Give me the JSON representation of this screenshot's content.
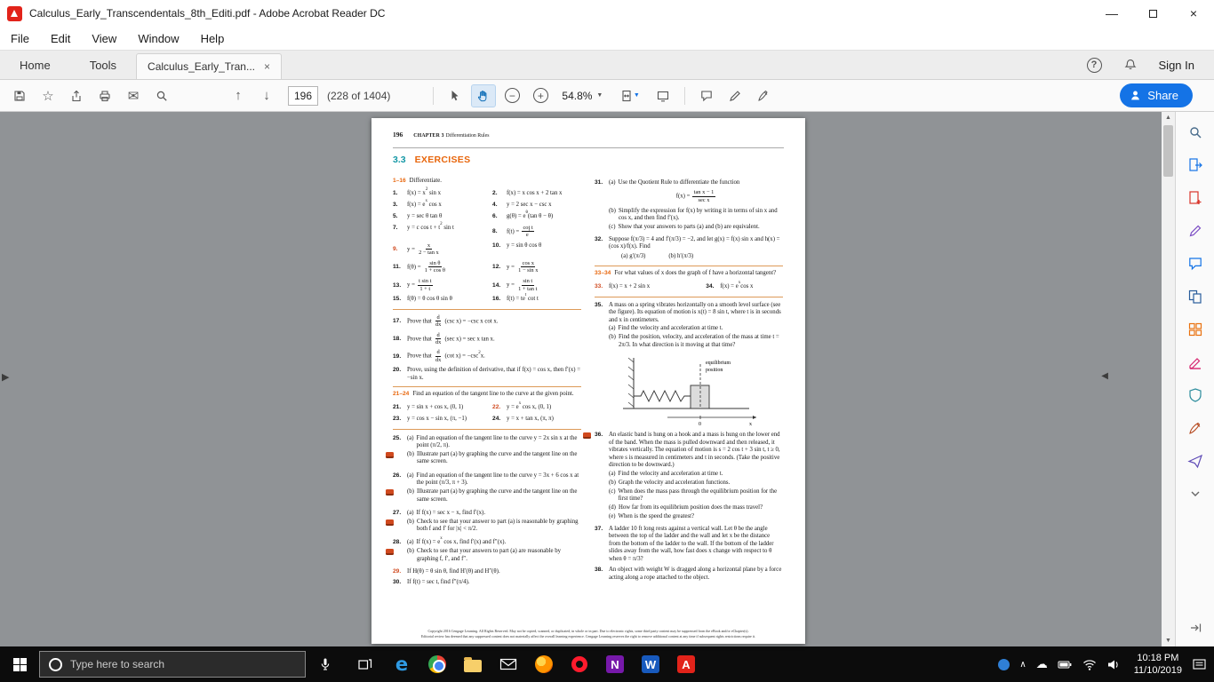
{
  "theme": {
    "accent_blue": "#1473e6",
    "teal": "#1598a6",
    "orange": "#e8660c",
    "red_num": "#d0491e",
    "acrobat_red": "#e2231a",
    "workspace": "#909396"
  },
  "titlebar": {
    "title": "Calculus_Early_Transcendentals_8th_Editi.pdf - Adobe Acrobat Reader DC"
  },
  "menubar": {
    "items": [
      "File",
      "Edit",
      "View",
      "Window",
      "Help"
    ]
  },
  "tabbar": {
    "home": "Home",
    "tools": "Tools",
    "doc": "Calculus_Early_Tran...",
    "sign_in": "Sign In"
  },
  "toolbar": {
    "page_current": "196",
    "page_total": "(228 of 1404)",
    "zoom_level": "54.8%",
    "share_label": "Share"
  },
  "glyphs": {
    "close": "×",
    "minimize": "—",
    "star": "☆",
    "email": "✉",
    "page_up": "↑",
    "page_down": "↓",
    "caret": "▼",
    "scroll_up": "▲",
    "scroll_down": "▼",
    "pane_right": "▶",
    "pane_left": "◀",
    "tray_chevron": "∧",
    "cloud": "☁",
    "help": "?",
    "zoom_minus": "−",
    "zoom_plus": "+",
    "tab_close": "×"
  },
  "page": {
    "folio": "196",
    "chapter_label": "CHAPTER 3",
    "chapter_title": "Differentiation Rules",
    "section_number": "3.3",
    "section_title": "EXERCISES",
    "g1": {
      "range": "1–16",
      "text": "Differentiate."
    },
    "ex_1_16": [
      {
        "n": "1.",
        "m": "f(x) = x^2^ sin x"
      },
      {
        "n": "2.",
        "m": "f(x) = x cos x + 2 tan x"
      },
      {
        "n": "3.",
        "m": "f(x) = e^x^ cos x"
      },
      {
        "n": "4.",
        "m": "y = 2 sec x − csc x"
      },
      {
        "n": "5.",
        "m": "y = sec θ tan θ"
      },
      {
        "n": "6.",
        "m": "g(θ) = e^θ^(tan θ − θ)"
      },
      {
        "n": "7.",
        "m": "y = c cos t + t^2^ sin t"
      },
      {
        "n": "8.",
        "m": "f(t) = [[cot t||e^t^]]"
      },
      {
        "n": "9.",
        "red": true,
        "m": "y = [[x||2 − tan x]]"
      },
      {
        "n": "10.",
        "m": "y = sin θ cos θ"
      },
      {
        "n": "11.",
        "m": "f(θ) = [[sin θ||1 + cos θ]]"
      },
      {
        "n": "12.",
        "m": "y = [[cos x||1 − sin x]]"
      },
      {
        "n": "13.",
        "m": "y = [[t sin t||1 + t]]"
      },
      {
        "n": "14.",
        "m": "y = [[sin t||1 + tan t]]"
      },
      {
        "n": "15.",
        "m": "f(θ) = θ cos θ sin θ"
      },
      {
        "n": "16.",
        "m": "f(t) = te^t^ cot t"
      }
    ],
    "ex_17_20": [
      {
        "n": "17.",
        "m": "Prove that [[d||dx]] (csc x) = −csc x cot x."
      },
      {
        "n": "18.",
        "m": "Prove that [[d||dx]] (sec x) = sec x tan x."
      },
      {
        "n": "19.",
        "m": "Prove that [[d||dx]] (cot x) = −csc^2^x."
      },
      {
        "n": "20.",
        "m": "Prove, using the definition of derivative, that if f(x) = cos x, then f′(x) = −sin x."
      }
    ],
    "g2": {
      "range": "21–24",
      "text": "Find an equation of the tangent line to the curve at the given point."
    },
    "ex_21_24": [
      {
        "n": "21.",
        "m": "y = sin x + cos x,  (0, 1)"
      },
      {
        "n": "22.",
        "red": true,
        "m": "y = e^x^ cos x,  (0, 1)"
      },
      {
        "n": "23.",
        "m": "y = cos x − sin x,  (π, −1)"
      },
      {
        "n": "24.",
        "m": "y = x + tan x,  (π, π)"
      }
    ],
    "ex_25_30": [
      {
        "n": "25.",
        "parts": [
          {
            "p": "(a)",
            "m": "Find an equation of the tangent line to the curve y = 2x sin x at the point (π/2, π)."
          },
          {
            "p": "(b)",
            "icon": true,
            "m": "Illustrate part (a) by graphing the curve and the tangent line on the same screen."
          }
        ]
      },
      {
        "n": "26.",
        "parts": [
          {
            "p": "(a)",
            "m": "Find an equation of the tangent line to the curve y = 3x + 6 cos x at the point (π/3, π + 3)."
          },
          {
            "p": "(b)",
            "icon": true,
            "m": "Illustrate part (a) by graphing the curve and the tangent line on the same screen."
          }
        ]
      },
      {
        "n": "27.",
        "parts": [
          {
            "p": "(a)",
            "m": "If f(x) = sec x − x, find f′(x)."
          },
          {
            "p": "(b)",
            "icon": true,
            "m": "Check to see that your answer to part (a) is reasonable by graphing both f and f′ for |x| < π/2."
          }
        ]
      },
      {
        "n": "28.",
        "parts": [
          {
            "p": "(a)",
            "m": "If f(x) = e^x^ cos x, find f′(x) and f″(x)."
          },
          {
            "p": "(b)",
            "icon": true,
            "m": "Check to see that your answers to part (a) are reasonable by graphing f, f′, and f″."
          }
        ]
      },
      {
        "n": "29.",
        "red": true,
        "m": "If H(θ) = θ sin θ, find H′(θ) and H″(θ)."
      },
      {
        "n": "30.",
        "m": "If f(t) = sec t, find f″(π/4)."
      }
    ],
    "ex_31": {
      "n": "31.",
      "parts": [
        {
          "p": "(a)",
          "m": "Use the Quotient Rule to differentiate the function",
          "display": "f(x) = [[tan x − 1||sec x]]"
        },
        {
          "p": "(b)",
          "m": "Simplify the expression for f(x) by writing it in terms of sin x and cos x, and then find f′(x)."
        },
        {
          "p": "(c)",
          "m": "Show that your answers to parts (a) and (b) are equivalent."
        }
      ]
    },
    "ex_32": {
      "n": "32.",
      "m": "Suppose f(π/3) = 4 and f′(π/3) = −2, and let g(x) = f(x) sin x and h(x) = (cos x)/f(x). Find",
      "sub": [
        {
          "p": "(a)",
          "m": "g′(π/3)"
        },
        {
          "p": "(b)",
          "m": "h′(π/3)"
        }
      ]
    },
    "g3": {
      "range": "33–34",
      "text": "For what values of x does the graph of f have a horizontal tangent?"
    },
    "ex_33_34": [
      {
        "n": "33.",
        "red": true,
        "m": "f(x) = x + 2 sin x"
      },
      {
        "n": "34.",
        "m": "f(x) = e^x^cos x"
      }
    ],
    "ex_35": {
      "n": "35.",
      "m": "A mass on a spring vibrates horizontally on a smooth level surface (see the figure). Its equation of motion is x(t) = 8 sin t, where t is in seconds and x in centimeters.",
      "parts": [
        {
          "p": "(a)",
          "m": "Find the velocity and acceleration at time t."
        },
        {
          "p": "(b)",
          "m": "Find the position, velocity, and acceleration of the mass at time t = 2π/3. In what direction is it moving at that time?"
        }
      ],
      "figure": {
        "label1": "equilibrium",
        "label2": "position",
        "origin": "0",
        "axis_label": "x"
      }
    },
    "ex_36": {
      "n": "36.",
      "icon": true,
      "m": "An elastic band is hung on a hook and a mass is hung on the lower end of the band. When the mass is pulled downward and then released, it vibrates vertically. The equation of motion is s = 2 cos t + 3 sin t, t ≥ 0, where s is measured in centimeters and t in seconds. (Take the positive direction to be downward.)",
      "parts": [
        {
          "p": "(a)",
          "m": "Find the velocity and acceleration at time t."
        },
        {
          "p": "(b)",
          "m": "Graph the velocity and acceleration functions."
        },
        {
          "p": "(c)",
          "m": "When does the mass pass through the equilibrium position for the first time?"
        },
        {
          "p": "(d)",
          "m": "How far from its equilibrium position does the mass travel?"
        },
        {
          "p": "(e)",
          "m": "When is the speed the greatest?"
        }
      ]
    },
    "ex_37": {
      "n": "37.",
      "m": "A ladder 10 ft long rests against a vertical wall. Let θ be the angle between the top of the ladder and the wall and let x be the distance from the bottom of the ladder to the wall. If the bottom of the ladder slides away from the wall, how fast does x change with respect to θ when θ = π/3?"
    },
    "ex_38": {
      "n": "38.",
      "m": "An object with weight W is dragged along a horizontal plane by a force acting along a rope attached to the object."
    },
    "footer_line1": "Copyright 2016 Cengage Learning. All Rights Reserved. May not be copied, scanned, or duplicated, in whole or in part. Due to electronic rights, some third party content may be suppressed from the eBook and/or eChapter(s).",
    "footer_line2": "Editorial review has deemed that any suppressed content does not materially affect the overall learning experience. Cengage Learning reserves the right to remove additional content at any time if subsequent rights restrictions require it."
  },
  "taskbar": {
    "search_placeholder": "Type here to search",
    "time": "10:18 PM",
    "date": "11/10/2019"
  }
}
